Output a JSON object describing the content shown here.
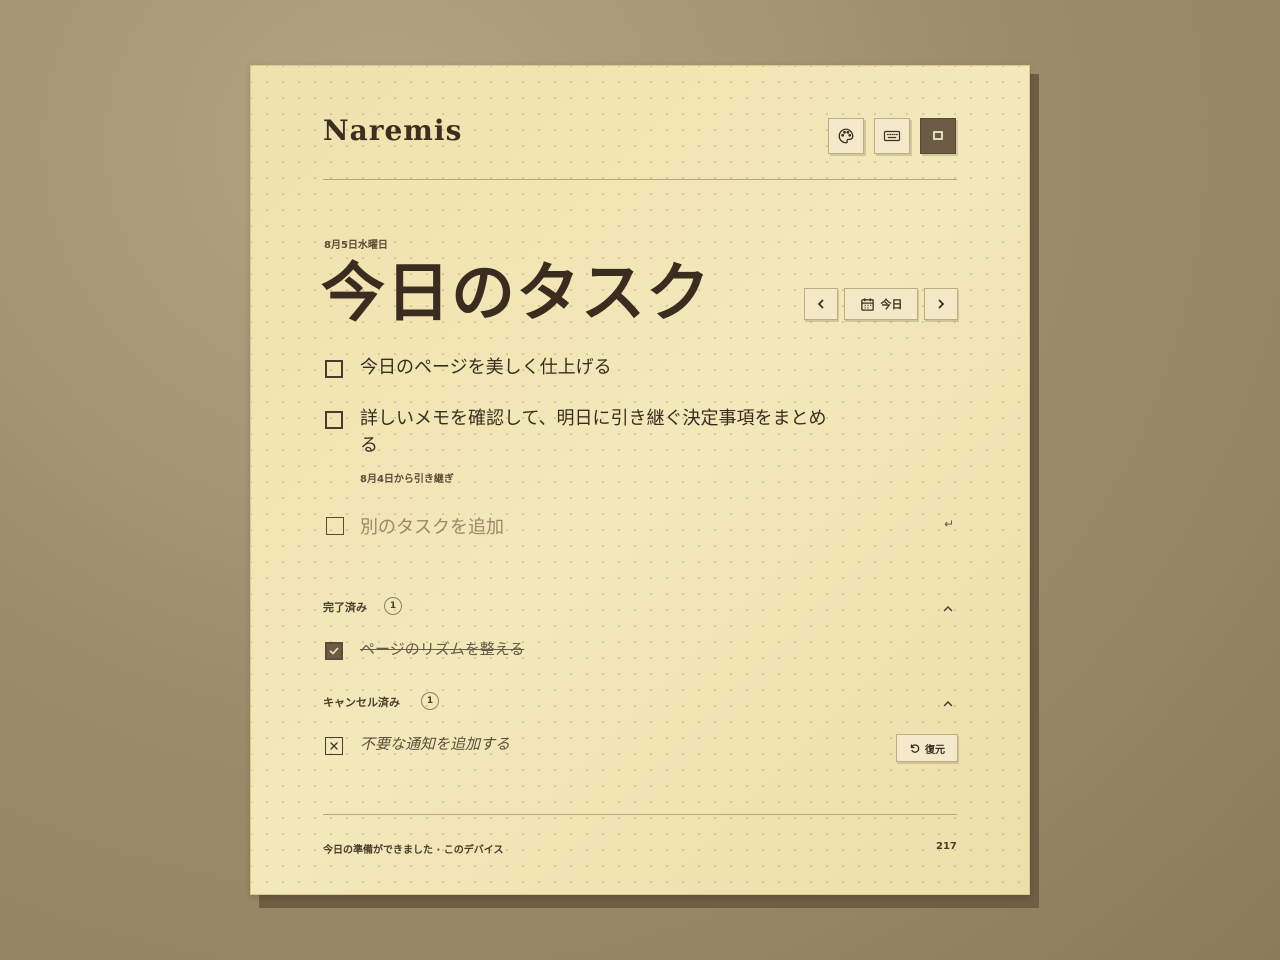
{
  "app": {
    "name": "Naremis"
  },
  "toolbar": {
    "icons": [
      "palette-icon",
      "keyboard-icon",
      "square-icon"
    ]
  },
  "header": {
    "date": "8月5日水曜日",
    "title": "今日のタスク"
  },
  "date_nav": {
    "prev_icon": "chevron-left-icon",
    "today_label": "今日",
    "next_icon": "chevron-right-icon"
  },
  "tasks": [
    {
      "text": "今日のページを美しく仕上げる"
    },
    {
      "text": "詳しいメモを確認して、明日に引き継ぐ決定事項をまとめる",
      "carry_note": "8月4日から引き継ぎ"
    }
  ],
  "add_task": {
    "placeholder": "別のタスクを追加",
    "enter_glyph": "↵"
  },
  "completed": {
    "label": "完了済み",
    "count": "1",
    "items": [
      {
        "text": "ページのリズムを整える"
      }
    ]
  },
  "cancelled": {
    "label": "キャンセル済み",
    "count": "1",
    "items": [
      {
        "text": "不要な通知を追加する",
        "restore_label": "復元"
      }
    ]
  },
  "footer": {
    "status": "今日の準備ができました · このデバイス",
    "count": "217"
  },
  "colors": {
    "paper": "#f1e5b5",
    "ink": "#3a2d20",
    "accent": "#6b5a44"
  }
}
